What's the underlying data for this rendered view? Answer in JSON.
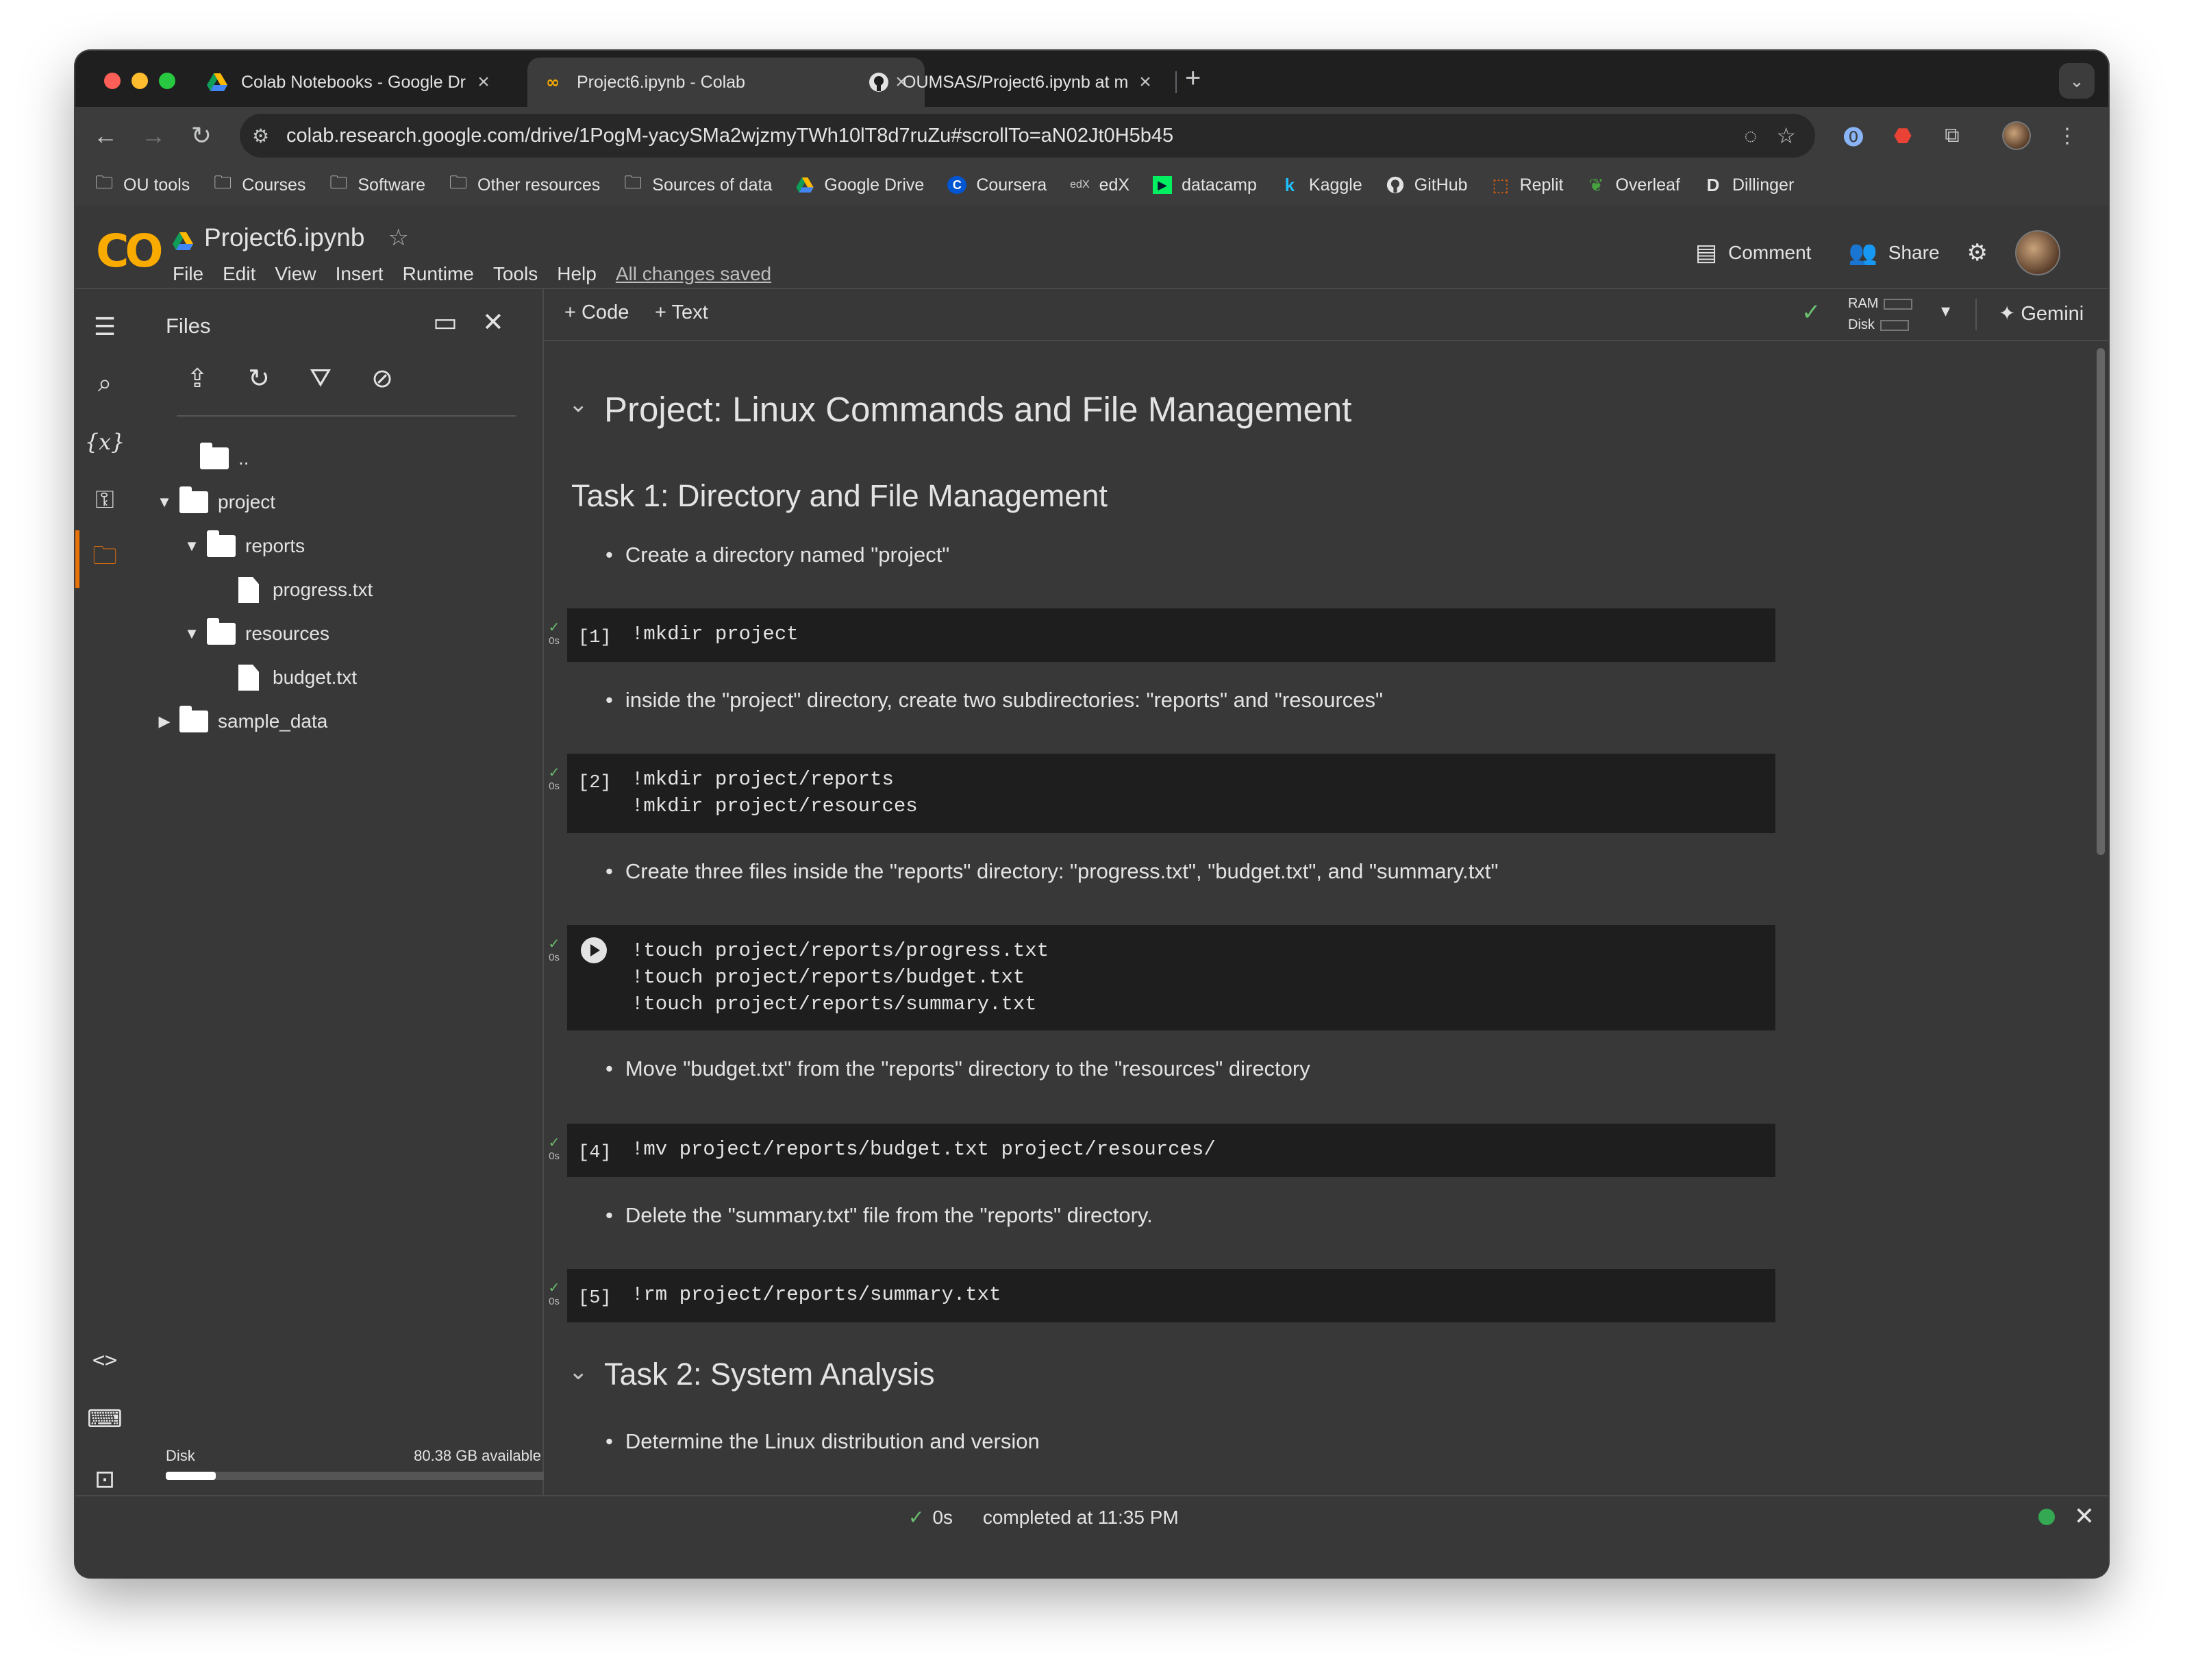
{
  "browser": {
    "tabs": [
      {
        "title": "Colab Notebooks - Google Dr",
        "active": false,
        "icon": "google-drive-icon"
      },
      {
        "title": "Project6.ipynb - Colab",
        "active": true,
        "icon": "colab-icon"
      },
      {
        "title": "OUMSAS/Project6.ipynb at m",
        "active": false,
        "icon": "github-icon"
      }
    ],
    "url": "colab.research.google.com/drive/1PogM-yacySMa2wjzmyTWh10lT8d7ruZu#scrollTo=aN02Jt0H5b45",
    "bookmarks": [
      {
        "label": "OU tools",
        "icon": "folder-icon"
      },
      {
        "label": "Courses",
        "icon": "folder-icon"
      },
      {
        "label": "Software",
        "icon": "folder-icon"
      },
      {
        "label": "Other resources",
        "icon": "folder-icon"
      },
      {
        "label": "Sources of data",
        "icon": "folder-icon"
      },
      {
        "label": "Google Drive",
        "icon": "google-drive-icon"
      },
      {
        "label": "Coursera",
        "icon": "coursera-icon"
      },
      {
        "label": "edX",
        "icon": "edx-icon"
      },
      {
        "label": "datacamp",
        "icon": "datacamp-icon"
      },
      {
        "label": "Kaggle",
        "icon": "kaggle-icon"
      },
      {
        "label": "GitHub",
        "icon": "github-icon"
      },
      {
        "label": "Replit",
        "icon": "replit-icon"
      },
      {
        "label": "Overleaf",
        "icon": "overleaf-icon"
      },
      {
        "label": "Dillinger",
        "icon": "dillinger-icon"
      }
    ]
  },
  "colab": {
    "logo_text": "CO",
    "notebook_title": "Project6.ipynb",
    "menu": [
      "File",
      "Edit",
      "View",
      "Insert",
      "Runtime",
      "Tools",
      "Help"
    ],
    "save_status": "All changes saved",
    "comment_label": "Comment",
    "share_label": "Share",
    "add_code_label": "+ Code",
    "add_text_label": "+ Text",
    "ram_label": "RAM",
    "disk_label": "Disk",
    "gemini_label": "Gemini"
  },
  "files_panel": {
    "title": "Files",
    "parent_label": "..",
    "tree": [
      {
        "name": "project",
        "type": "folder",
        "expanded": true,
        "level": 0
      },
      {
        "name": "reports",
        "type": "folder",
        "expanded": true,
        "level": 1
      },
      {
        "name": "progress.txt",
        "type": "file",
        "level": 2
      },
      {
        "name": "resources",
        "type": "folder",
        "expanded": true,
        "level": 1
      },
      {
        "name": "budget.txt",
        "type": "file",
        "level": 2
      },
      {
        "name": "sample_data",
        "type": "folder",
        "expanded": false,
        "level": 0
      }
    ],
    "disk_label": "Disk",
    "disk_available": "80.38 GB available",
    "disk_used_fraction": 0.13
  },
  "notebook": {
    "h1": "Project: Linux Commands and File Management",
    "task1_heading": "Task 1: Directory and File Management",
    "bullets": [
      "Create a directory named \"project\"",
      "inside the \"project\" directory, create two subdirectories: \"reports\" and \"resources\"",
      "Create three files inside the \"reports\" directory: \"progress.txt\", \"budget.txt\", and \"summary.txt\"",
      "Move \"budget.txt\" from the \"reports\" directory to the \"resources\" directory",
      "Delete the \"summary.txt\" file from the \"reports\" directory."
    ],
    "cells": [
      {
        "exec": "[1]",
        "code": "!mkdir project",
        "time": "0s"
      },
      {
        "exec": "[2]",
        "code": "!mkdir project/reports\n!mkdir project/resources",
        "time": "0s"
      },
      {
        "exec": "",
        "code": "!touch project/reports/progress.txt\n!touch project/reports/budget.txt\n!touch project/reports/summary.txt",
        "time": "0s"
      },
      {
        "exec": "[4]",
        "code": "!mv project/reports/budget.txt project/resources/",
        "time": "0s"
      },
      {
        "exec": "[5]",
        "code": "!rm project/reports/summary.txt",
        "time": "0s"
      }
    ],
    "task2_heading": "Task 2: System Analysis",
    "task2_bullet": "Determine the Linux distribution and version"
  },
  "status_bar": {
    "duration": "0s",
    "completed": "completed at 11:35 PM"
  }
}
